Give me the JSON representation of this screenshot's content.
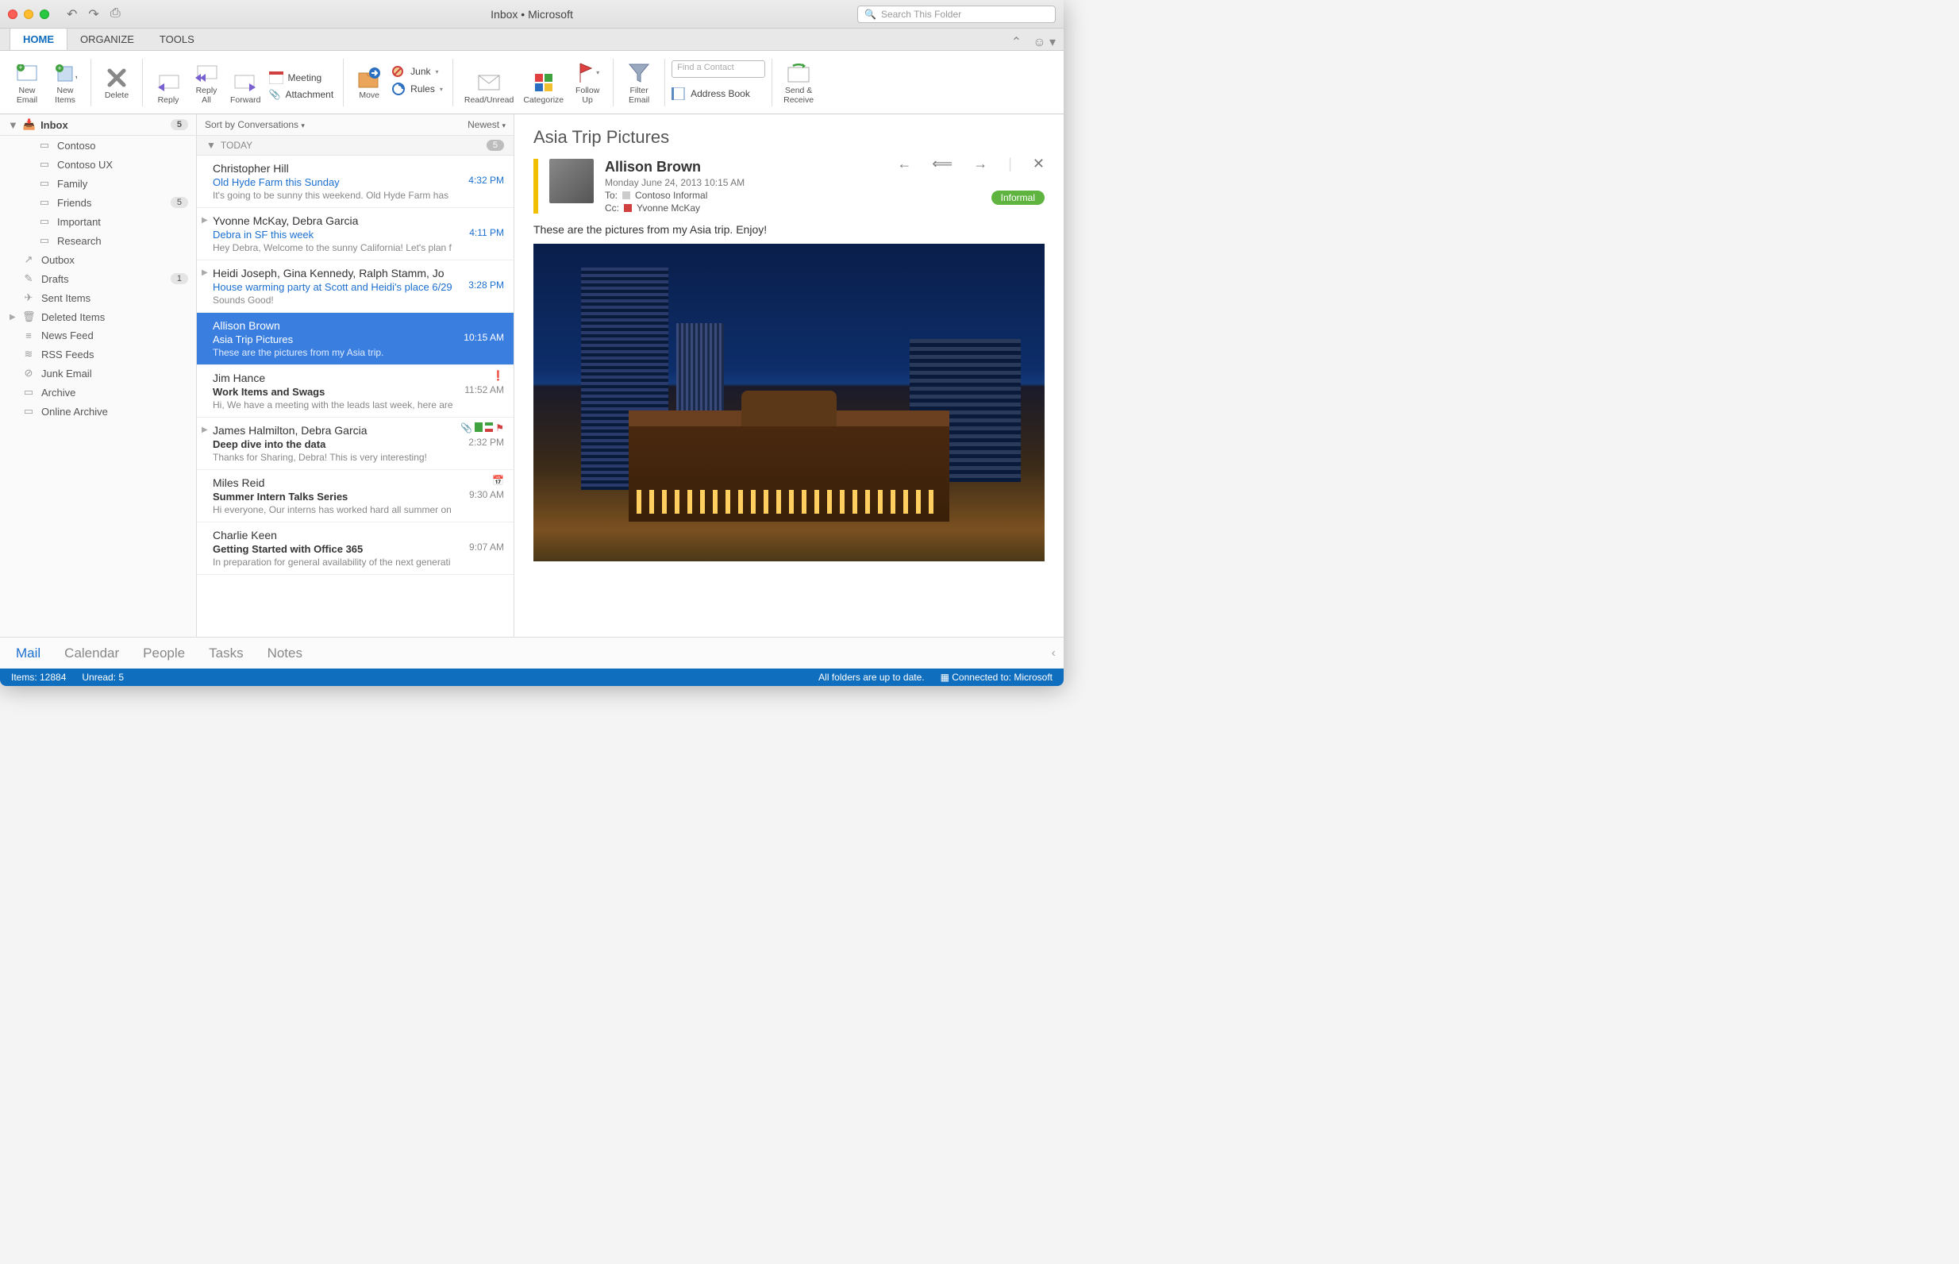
{
  "window": {
    "title": "Inbox • Microsoft"
  },
  "search": {
    "placeholder": "Search This Folder"
  },
  "tabs": {
    "home": "HOME",
    "organize": "ORGANIZE",
    "tools": "TOOLS"
  },
  "ribbon": {
    "newEmail": "New\nEmail",
    "newItems": "New\nItems",
    "delete": "Delete",
    "reply": "Reply",
    "replyAll": "Reply\nAll",
    "forward": "Forward",
    "meeting": "Meeting",
    "attachment": "Attachment",
    "move": "Move",
    "junk": "Junk",
    "rules": "Rules",
    "readUnread": "Read/Unread",
    "categorize": "Categorize",
    "followUp": "Follow\nUp",
    "filterEmail": "Filter\nEmail",
    "findContact": "Find a Contact",
    "addressBook": "Address Book",
    "sendReceive": "Send &\nReceive"
  },
  "sidebar": {
    "inbox": {
      "label": "Inbox",
      "count": "5"
    },
    "folders": [
      {
        "label": "Contoso"
      },
      {
        "label": "Contoso UX"
      },
      {
        "label": "Family"
      },
      {
        "label": "Friends",
        "count": "5"
      },
      {
        "label": "Important"
      },
      {
        "label": "Research"
      }
    ],
    "others": [
      {
        "icon": "↗",
        "label": "Outbox"
      },
      {
        "icon": "✎",
        "label": "Drafts",
        "count": "1"
      },
      {
        "icon": "✈",
        "label": "Sent Items"
      },
      {
        "icon": "🗑",
        "label": "Deleted Items",
        "caret": true
      },
      {
        "icon": "≡",
        "label": "News Feed"
      },
      {
        "icon": "≋",
        "label": "RSS Feeds"
      },
      {
        "icon": "⊘",
        "label": "Junk Email"
      },
      {
        "icon": "▭",
        "label": "Archive"
      },
      {
        "icon": "▭",
        "label": "Online Archive"
      }
    ]
  },
  "msglist": {
    "sortLeft": "Sort by Conversations",
    "sortRight": "Newest",
    "today": "TODAY",
    "todayCount": "5",
    "msgs": [
      {
        "from": "Christopher Hill",
        "subj": "Old Hyde Farm this Sunday",
        "prev": "It's going to be sunny this weekend. Old Hyde Farm has",
        "time": "4:32 PM",
        "blue": true
      },
      {
        "from": "Yvonne McKay, Debra Garcia",
        "subj": "Debra in SF this week",
        "prev": "Hey Debra, Welcome to the sunny California! Let's plan f",
        "time": "4:11 PM",
        "blue": true,
        "caret": true
      },
      {
        "from": "Heidi Joseph, Gina Kennedy, Ralph Stamm, Jo",
        "subj": "House warming party at Scott and Heidi's place 6/29",
        "prev": "Sounds Good!",
        "time": "3:28 PM",
        "blue": true,
        "caret": true
      },
      {
        "from": "Allison Brown",
        "subj": "Asia Trip Pictures",
        "prev": "These are the pictures from my Asia trip.",
        "time": "10:15 AM",
        "selected": true
      },
      {
        "from": "Jim Hance",
        "subj": "Work Items and Swags",
        "prev": "Hi, We have a meeting with the leads last week, here are",
        "time": "11:52 AM",
        "black": true,
        "importance": true
      },
      {
        "from": "James Halmilton, Debra Garcia",
        "subj": "Deep dive into the data",
        "prev": "Thanks for Sharing, Debra! This is very interesting!",
        "time": "2:32 PM",
        "black": true,
        "caret": true,
        "attach": true
      },
      {
        "from": "Miles Reid",
        "subj": "Summer Intern Talks Series",
        "prev": "Hi everyone, Our interns has worked hard all summer on",
        "time": "9:30 AM",
        "black": true,
        "cal": true
      },
      {
        "from": "Charlie Keen",
        "subj": "Getting Started with Office 365",
        "prev": "In preparation for general availability of the next generati",
        "time": "9:07 AM",
        "black": true
      }
    ]
  },
  "reader": {
    "subject": "Asia Trip Pictures",
    "from": "Allison Brown",
    "date": "Monday June 24, 2013 10:15 AM",
    "toLabel": "To:",
    "to": "Contoso Informal",
    "ccLabel": "Cc:",
    "cc": "Yvonne McKay",
    "tag": "Informal",
    "body": "These are the pictures from my Asia trip.   Enjoy!"
  },
  "bottomnav": {
    "mail": "Mail",
    "calendar": "Calendar",
    "people": "People",
    "tasks": "Tasks",
    "notes": "Notes"
  },
  "status": {
    "items": "Items: 12884",
    "unread": "Unread: 5",
    "uptodate": "All folders are up to date.",
    "connected": "Connected to: Microsoft"
  }
}
